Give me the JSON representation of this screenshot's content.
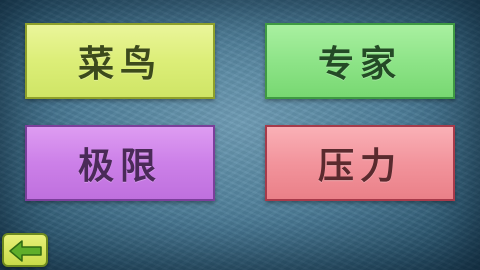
{
  "menu": {
    "buttons": [
      {
        "id": "rookie",
        "label": "菜鸟",
        "color": "#dcee78"
      },
      {
        "id": "expert",
        "label": "专家",
        "color": "#8ee488"
      },
      {
        "id": "extreme",
        "label": "极限",
        "color": "#cc80e8"
      },
      {
        "id": "pressure",
        "label": "压力",
        "color": "#f2949c"
      }
    ]
  },
  "back_button": {
    "icon": "back-arrow-icon",
    "color": "#c9dc4a",
    "arrow_color": "#5fae2a"
  }
}
